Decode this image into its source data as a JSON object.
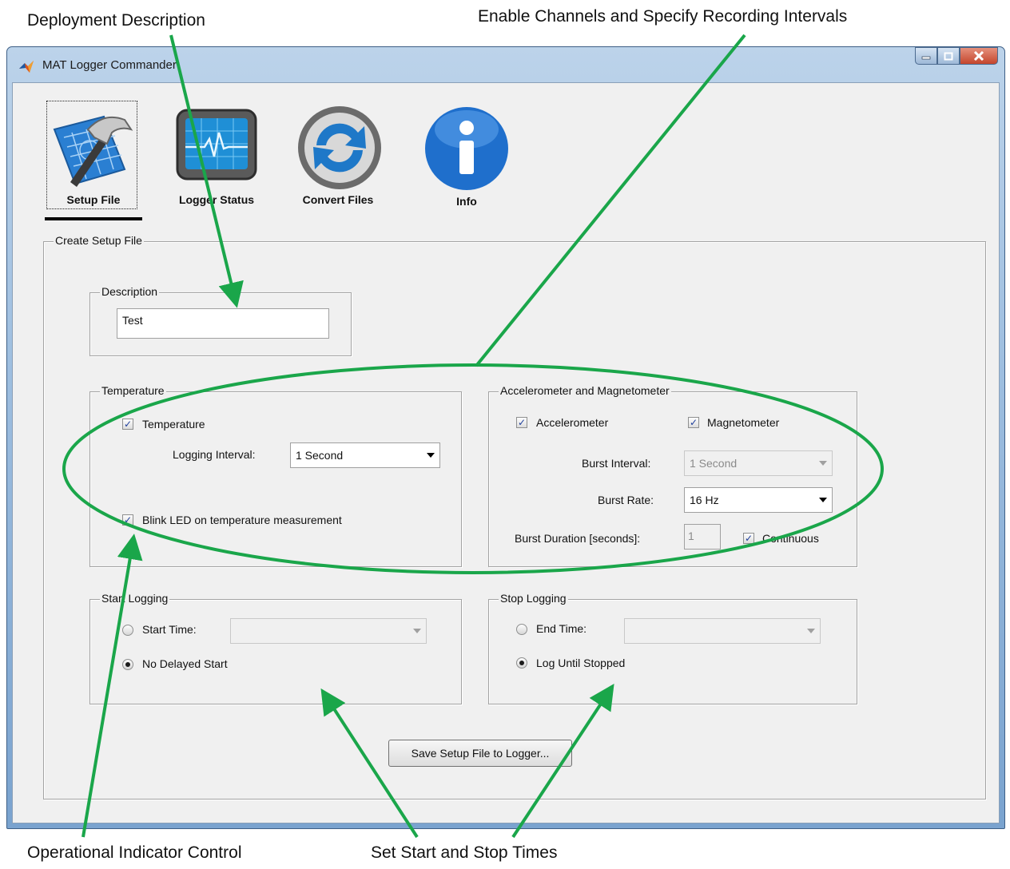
{
  "annotations": {
    "deployment_description": "Deployment Description",
    "enable_channels": "Enable Channels and Specify Recording Intervals",
    "operational_indicator": "Operational Indicator Control",
    "set_start_stop": "Set Start and Stop Times"
  },
  "window": {
    "title": "MAT Logger Commander",
    "controls": [
      "minimize",
      "maximize",
      "close"
    ]
  },
  "toolbar": {
    "setup_file": "Setup File",
    "logger_status": "Logger Status",
    "convert_files": "Convert Files",
    "info": "Info",
    "active": "setup_file"
  },
  "setup": {
    "panel_title": "Create Setup File",
    "description": {
      "label": "Description",
      "value": "Test"
    },
    "temperature": {
      "group_label": "Temperature",
      "checkbox_label": "Temperature",
      "checked": true,
      "logging_interval_label": "Logging Interval:",
      "logging_interval_value": "1 Second",
      "blink_led_label": "Blink LED on temperature measurement",
      "blink_led_checked": true
    },
    "accel_mag": {
      "group_label": "Accelerometer and Magnetometer",
      "accelerometer_label": "Accelerometer",
      "accelerometer_checked": true,
      "magnetometer_label": "Magnetometer",
      "magnetometer_checked": true,
      "burst_interval_label": "Burst Interval:",
      "burst_interval_value": "1 Second",
      "burst_rate_label": "Burst Rate:",
      "burst_rate_value": "16 Hz",
      "burst_duration_label": "Burst Duration [seconds]:",
      "burst_duration_value": "1",
      "continuous_label": "Continuous",
      "continuous_checked": true
    },
    "start_logging": {
      "group_label": "Start Logging",
      "start_time_label": "Start Time:",
      "no_delayed_start_label": "No Delayed Start",
      "selected": "no_delayed_start"
    },
    "stop_logging": {
      "group_label": "Stop Logging",
      "end_time_label": "End Time:",
      "log_until_stopped_label": "Log Until Stopped",
      "selected": "log_until_stopped"
    },
    "save_button": "Save Setup File to Logger..."
  },
  "colors": {
    "annotation_green": "#1aa64a",
    "title_gradient": "#9fbfe0",
    "panel_bg": "#f0f0f0"
  },
  "icons": [
    "matlab-icon",
    "hammer-blueprint-icon",
    "monitor-heartbeat-icon",
    "refresh-arrows-icon",
    "info-icon"
  ]
}
